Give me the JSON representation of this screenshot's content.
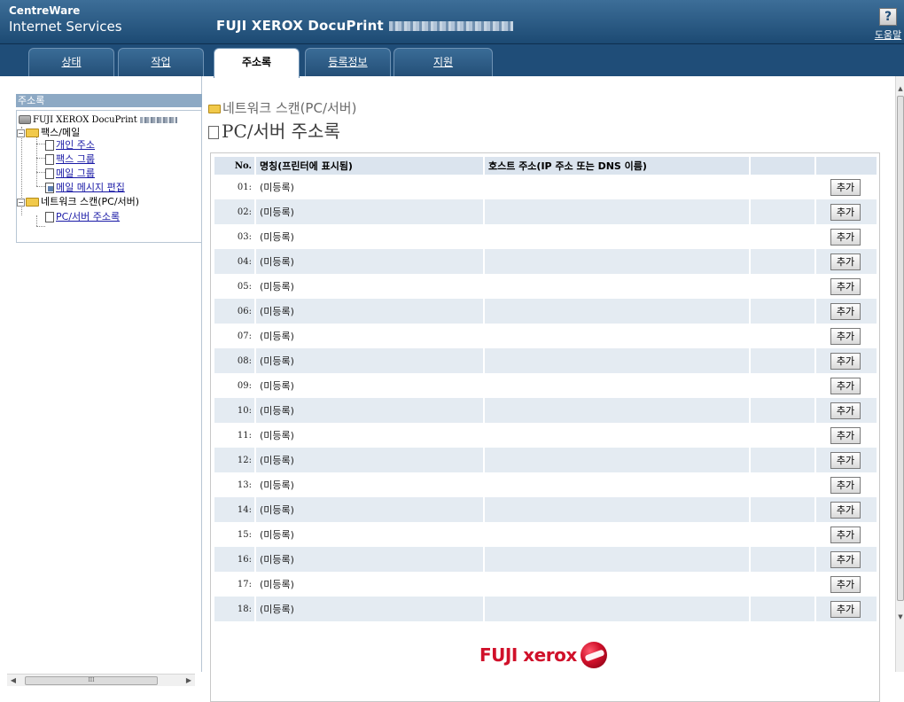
{
  "header": {
    "brand_line1": "CentreWare",
    "brand_line2": "Internet Services",
    "model": "FUJI XEROX DocuPrint",
    "help_icon_glyph": "?",
    "help_label": "도움말"
  },
  "tabs": [
    {
      "label": "상태",
      "active": false
    },
    {
      "label": "작업",
      "active": false
    },
    {
      "label": "주소록",
      "active": true
    },
    {
      "label": "등록정보",
      "active": false
    },
    {
      "label": "지원",
      "active": false
    }
  ],
  "sidebar": {
    "title": "주소록",
    "root": "FUJI XEROX DocuPrint",
    "fax_mail": {
      "label": "팩스/메일",
      "items": [
        "개인 주소",
        "팩스 그룹",
        "메일 그룹",
        "메일 메시지 편집"
      ]
    },
    "network_scan": {
      "label": "네트워크 스캔(PC/서버)",
      "items": [
        "PC/서버 주소록"
      ]
    },
    "scroll_grip": "III"
  },
  "main": {
    "breadcrumb": "네트워크 스캔(PC/서버)",
    "title": "PC/서버 주소록",
    "columns": {
      "no": "No.",
      "name": "명칭(프린터에 표시됨)",
      "host": "호스트 주소(IP 주소 또는 DNS 이름)"
    },
    "add_label": "추가",
    "rows": [
      {
        "no": "01:",
        "name": "(미등록)"
      },
      {
        "no": "02:",
        "name": "(미등록)"
      },
      {
        "no": "03:",
        "name": "(미등록)"
      },
      {
        "no": "04:",
        "name": "(미등록)"
      },
      {
        "no": "05:",
        "name": "(미등록)"
      },
      {
        "no": "06:",
        "name": "(미등록)"
      },
      {
        "no": "07:",
        "name": "(미등록)"
      },
      {
        "no": "08:",
        "name": "(미등록)"
      },
      {
        "no": "09:",
        "name": "(미등록)"
      },
      {
        "no": "10:",
        "name": "(미등록)"
      },
      {
        "no": "11:",
        "name": "(미등록)"
      },
      {
        "no": "12:",
        "name": "(미등록)"
      },
      {
        "no": "13:",
        "name": "(미등록)"
      },
      {
        "no": "14:",
        "name": "(미등록)"
      },
      {
        "no": "15:",
        "name": "(미등록)"
      },
      {
        "no": "16:",
        "name": "(미등록)"
      },
      {
        "no": "17:",
        "name": "(미등록)"
      },
      {
        "no": "18:",
        "name": "(미등록)"
      }
    ]
  },
  "footer": {
    "logo_text": "FUJI xerox"
  },
  "colors": {
    "header_bg": "#1f4d78",
    "row_alt": "#e4ebf2",
    "header_row": "#dbe4ee",
    "logo_red": "#d0102a",
    "link": "#1a1aa6"
  }
}
